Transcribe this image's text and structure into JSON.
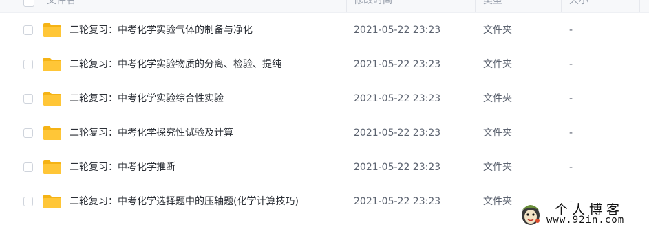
{
  "header": {
    "name_label": "文件名",
    "modified_label": "修改时间",
    "type_label": "类型",
    "size_label": "大小"
  },
  "files": [
    {
      "name": "二轮复习：中考化学实验气体的制备与净化",
      "modified": "2021-05-22 23:23",
      "type": "文件夹",
      "size": "-"
    },
    {
      "name": "二轮复习：中考化学实验物质的分离、检验、提纯",
      "modified": "2021-05-22 23:23",
      "type": "文件夹",
      "size": "-"
    },
    {
      "name": "二轮复习：中考化学实验综合性实验",
      "modified": "2021-05-22 23:23",
      "type": "文件夹",
      "size": "-"
    },
    {
      "name": "二轮复习：中考化学探究性试验及计算",
      "modified": "2021-05-22 23:23",
      "type": "文件夹",
      "size": "-"
    },
    {
      "name": "二轮复习：中考化学推断",
      "modified": "2021-05-22 23:23",
      "type": "文件夹",
      "size": "-"
    },
    {
      "name": "二轮复习：中考化学选择题中的压轴题(化学计算技巧)",
      "modified": "2021-05-22 23:23",
      "type": "文件夹",
      "size": "-"
    }
  ],
  "watermark": {
    "title": "个人博客",
    "url": "www.92in.com"
  },
  "colors": {
    "folder": "#ffc637",
    "folder_back": "#f5b315",
    "sort_accent": "#3b8cff"
  },
  "icons": {
    "folder": "folder-icon",
    "sort": "sort-down-icon",
    "logo": "mascot-icon"
  }
}
